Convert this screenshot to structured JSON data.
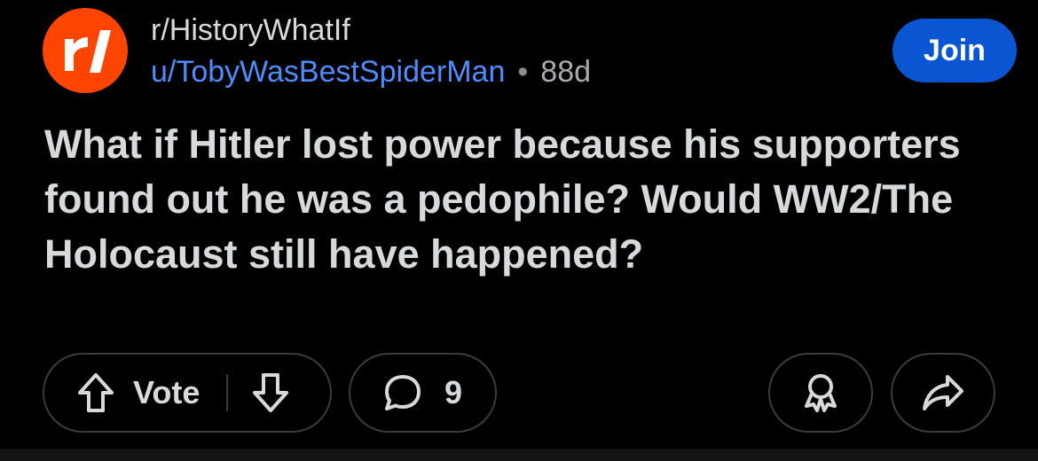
{
  "header": {
    "subreddit": "r/HistoryWhatIf",
    "username": "u/TobyWasBestSpiderMan",
    "separator": "•",
    "age": "88d",
    "join_label": "Join",
    "avatar_icon": "reddit-r-logo-icon"
  },
  "post": {
    "title": "What if Hitler lost power because his supporters found out he was a pedophile? Would WW2/The Holocaust still have happened?"
  },
  "actions": {
    "vote_label": "Vote",
    "comment_count": "9",
    "upvote_icon": "arrow-up-icon",
    "downvote_icon": "arrow-down-icon",
    "comment_icon": "comment-bubble-icon",
    "award_icon": "award-icon",
    "share_icon": "share-icon"
  },
  "colors": {
    "background": "#000000",
    "brand_orange": "#ff4500",
    "join_blue": "#0a55d2",
    "username_blue": "#4f8dfc",
    "text": "#d7dadc",
    "pill_border": "#3a3c3f"
  }
}
